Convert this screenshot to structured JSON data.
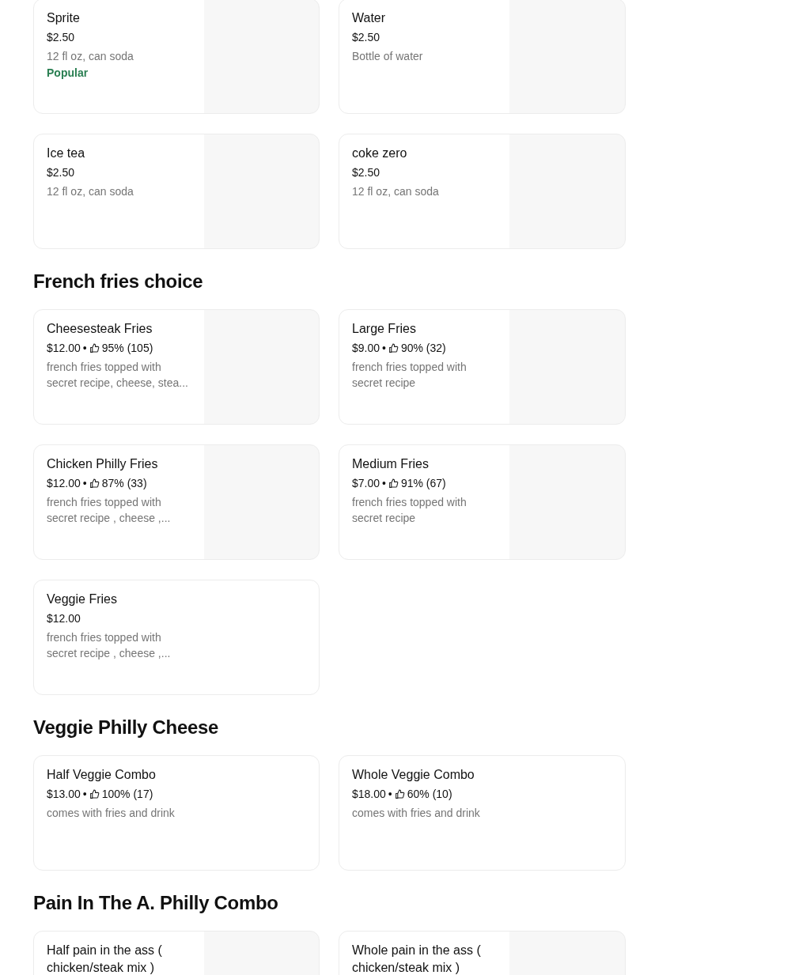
{
  "separator": "•",
  "sections": [
    {
      "items": [
        {
          "kind": "photo",
          "name": "Sprite",
          "price": "$2.50",
          "description": "12 fl oz, can soda",
          "badge": "Popular"
        },
        {
          "kind": "photo",
          "name": "Water",
          "price": "$2.50",
          "description": "Bottle of water"
        },
        {
          "kind": "photo",
          "name": "Ice tea",
          "price": "$2.50",
          "description": "12 fl oz, can soda"
        },
        {
          "kind": "photo",
          "name": "coke zero",
          "price": "$2.50",
          "description": "12 fl oz, can soda"
        }
      ]
    },
    {
      "title": "French fries choice",
      "items": [
        {
          "kind": "photo",
          "name": "Cheesesteak Fries",
          "price": "$12.00",
          "rating": "95% (105)",
          "description": "french fries topped with secret recipe, cheese, stea..."
        },
        {
          "kind": "photo",
          "name": "Large Fries",
          "price": "$9.00",
          "rating": "90% (32)",
          "description": "french fries topped with secret recipe"
        },
        {
          "kind": "photo",
          "name": "Chicken Philly Fries",
          "price": "$12.00",
          "rating": "87% (33)",
          "description": "french fries topped with secret recipe , cheese ,..."
        },
        {
          "kind": "photo",
          "name": "Medium Fries",
          "price": "$7.00",
          "rating": "91% (67)",
          "description": "french fries topped with secret recipe"
        },
        {
          "kind": "plain",
          "name": "Veggie Fries",
          "price": "$12.00",
          "description": "french fries topped with secret recipe , cheese ,..."
        }
      ]
    },
    {
      "title": "Veggie Philly Cheese",
      "items": [
        {
          "kind": "plain",
          "name": "Half Veggie Combo",
          "price": "$13.00",
          "rating": "100% (17)",
          "description": "comes with fries and drink"
        },
        {
          "kind": "plain",
          "name": "Whole Veggie Combo",
          "price": "$18.00",
          "rating": "60% (10)",
          "description": "comes with fries and drink"
        }
      ]
    },
    {
      "title": "Pain In The A. Philly Combo",
      "items": [
        {
          "kind": "photo",
          "name": "Half pain in the ass ( chicken/steak mix )"
        },
        {
          "kind": "photo",
          "name": "Whole pain in the ass ( chicken/steak mix )"
        }
      ]
    }
  ]
}
